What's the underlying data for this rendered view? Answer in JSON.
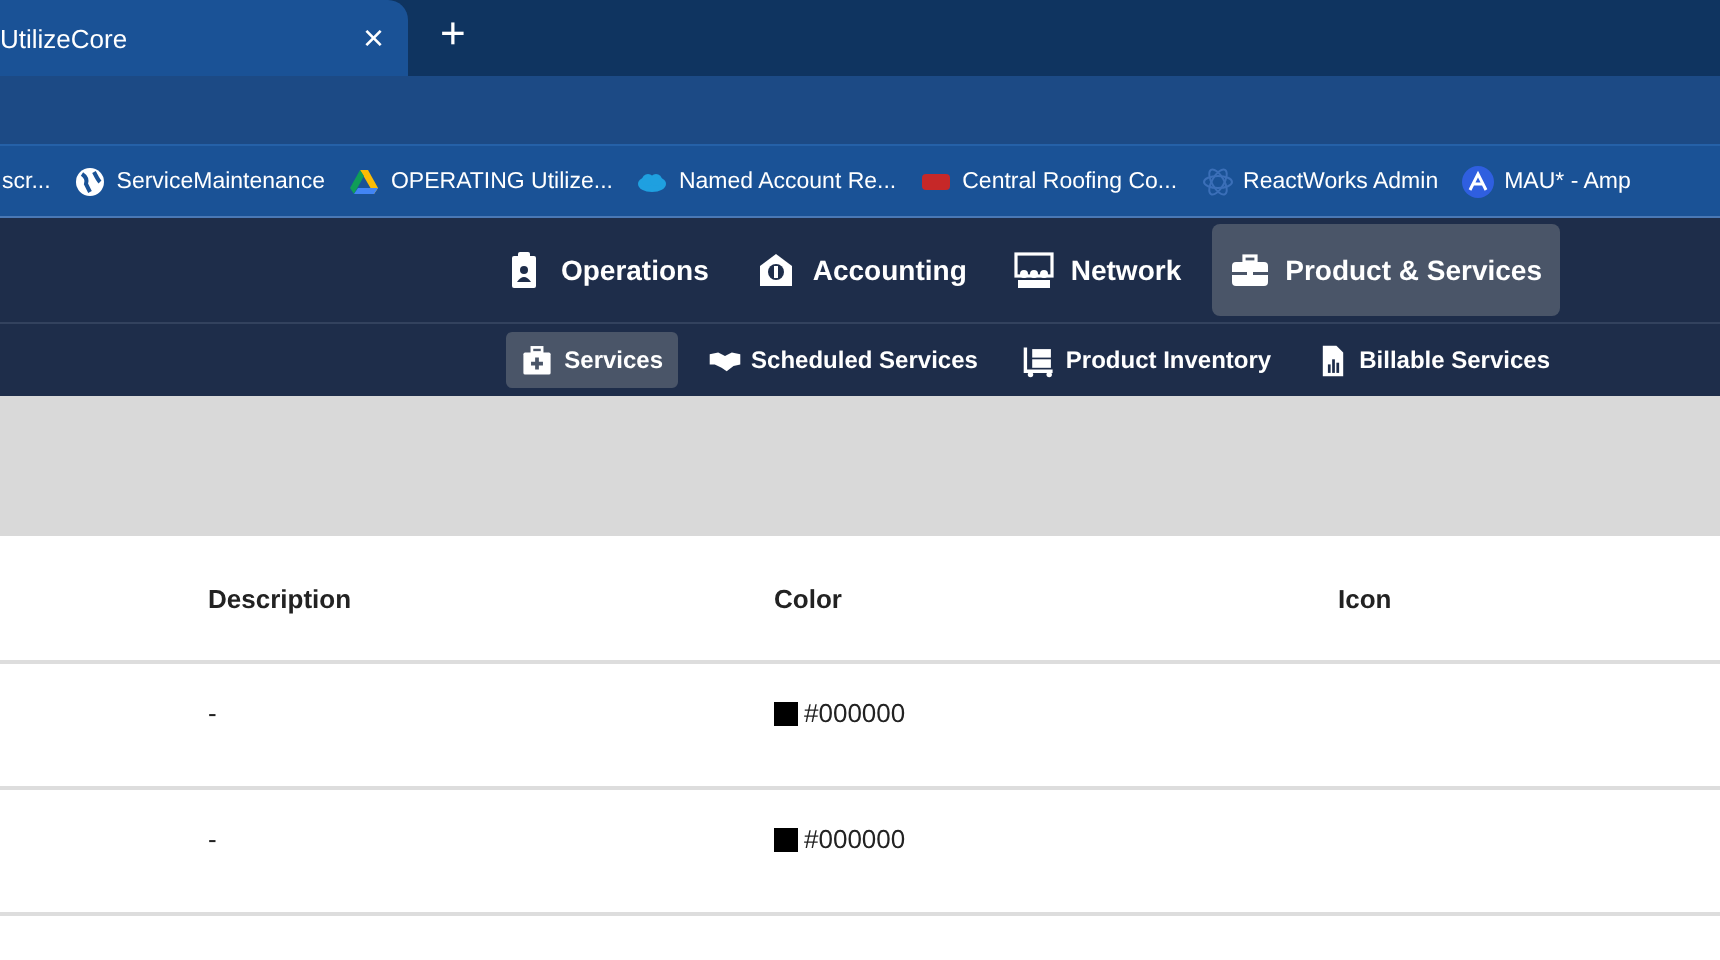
{
  "browser": {
    "tab": {
      "title": "UtilizeCore",
      "close": "×"
    },
    "new_tab": "+",
    "bookmarks": [
      {
        "label": "scr..."
      },
      {
        "label": "ServiceMaintenance"
      },
      {
        "label": "OPERATING Utilize..."
      },
      {
        "label": "Named Account Re..."
      },
      {
        "label": "Central Roofing Co..."
      },
      {
        "label": "ReactWorks Admin"
      },
      {
        "label": "MAU* - Amp"
      }
    ]
  },
  "nav": {
    "items": [
      {
        "label": "Operations",
        "selected": false
      },
      {
        "label": "Accounting",
        "selected": false
      },
      {
        "label": "Network",
        "selected": false
      },
      {
        "label": "Product & Services",
        "selected": true
      }
    ]
  },
  "subnav": {
    "items": [
      {
        "label": "Services",
        "selected": true
      },
      {
        "label": "Scheduled Services",
        "selected": false
      },
      {
        "label": "Product Inventory",
        "selected": false
      },
      {
        "label": "Billable Services",
        "selected": false
      }
    ]
  },
  "table": {
    "columns": [
      "Description",
      "Color",
      "Icon"
    ],
    "rows": [
      {
        "description": "-",
        "color": "#000000",
        "color_text": "#000000"
      },
      {
        "description": "-",
        "color": "#000000",
        "color_text": "#000000"
      }
    ]
  }
}
